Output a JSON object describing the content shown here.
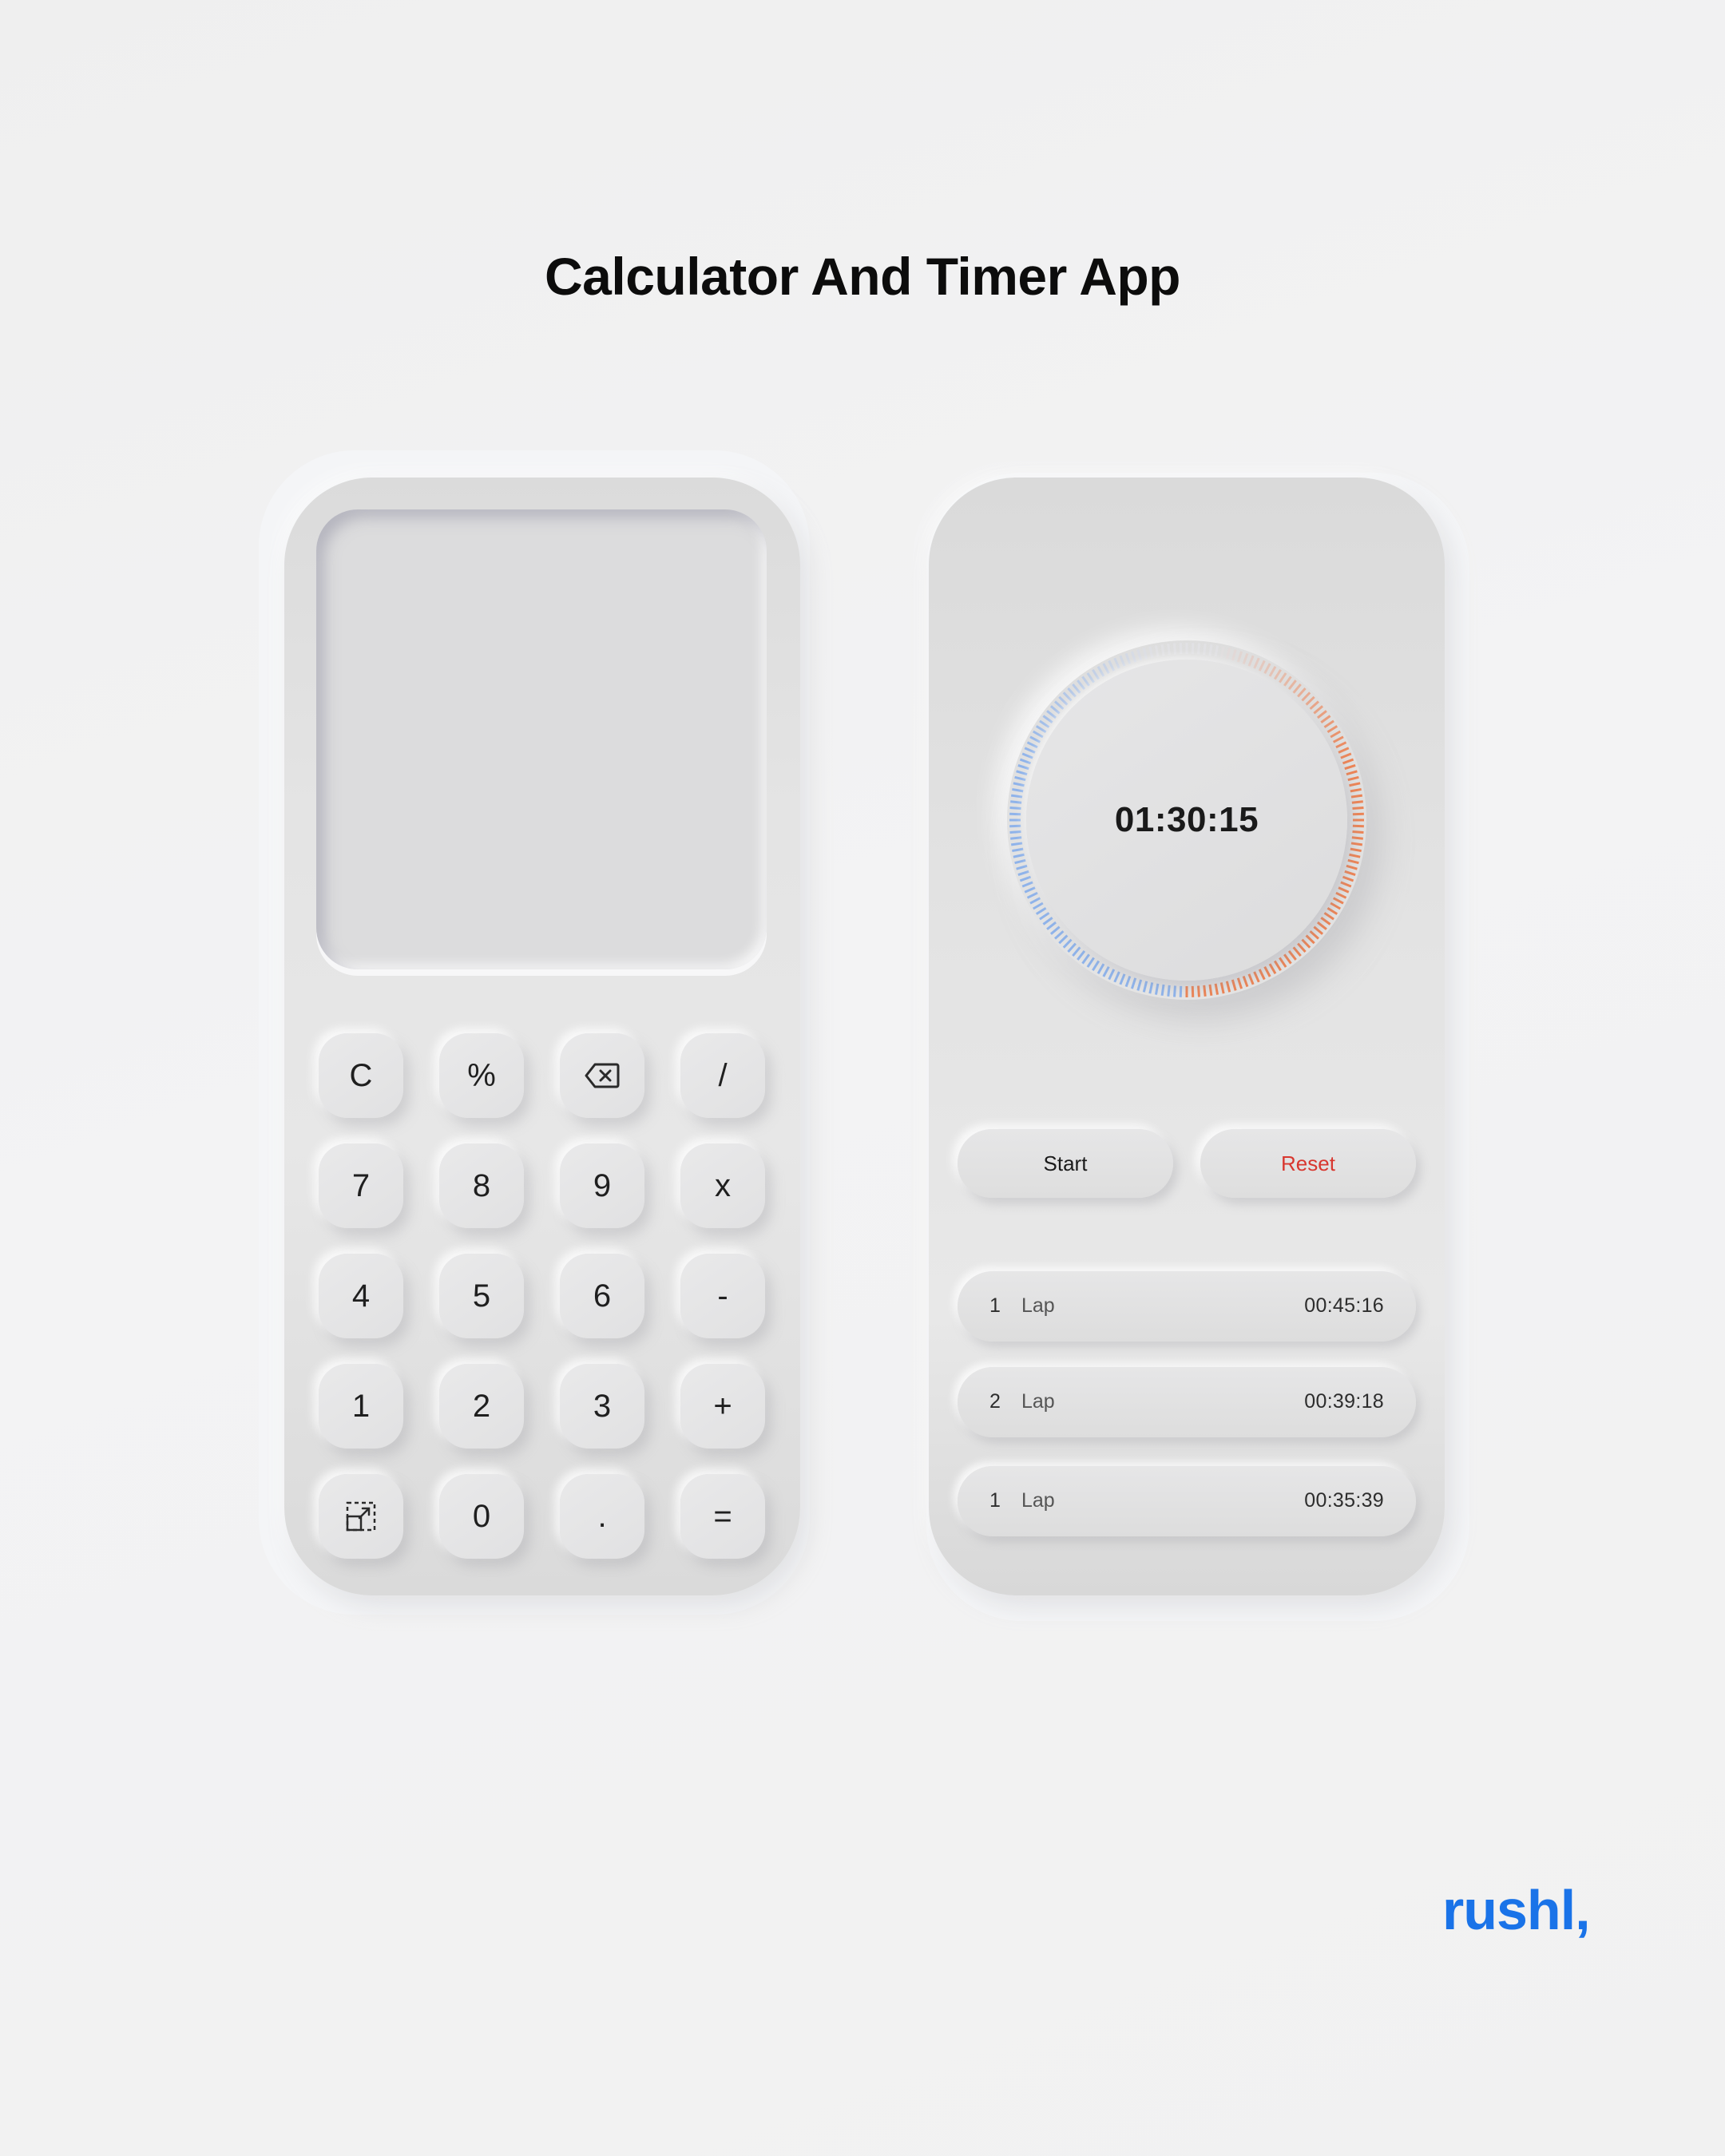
{
  "page": {
    "title": "Calculator And Timer App",
    "brand": "rushl,"
  },
  "colors": {
    "accent_blue": "#1a73e8",
    "reset_red": "#d8372f",
    "ring_blue": "#8fb3ea",
    "ring_orange": "#ec8456"
  },
  "calculator": {
    "display_value": "",
    "keys": [
      {
        "label": "C"
      },
      {
        "label": "%"
      },
      {
        "label": "",
        "icon": "backspace-icon"
      },
      {
        "label": "/"
      },
      {
        "label": "7"
      },
      {
        "label": "8"
      },
      {
        "label": "9"
      },
      {
        "label": "x"
      },
      {
        "label": "4"
      },
      {
        "label": "5"
      },
      {
        "label": "6"
      },
      {
        "label": "-"
      },
      {
        "label": "1"
      },
      {
        "label": "2"
      },
      {
        "label": "3"
      },
      {
        "label": "+"
      },
      {
        "label": "",
        "icon": "scale-icon"
      },
      {
        "label": "0"
      },
      {
        "label": "."
      },
      {
        "label": "="
      }
    ]
  },
  "timer": {
    "time": "01:30:15",
    "start_label": "Start",
    "reset_label": "Reset",
    "laps": [
      {
        "num": "1",
        "label": "Lap",
        "time": "00:45:16"
      },
      {
        "num": "2",
        "label": "Lap",
        "time": "00:39:18"
      },
      {
        "num": "1",
        "label": "Lap",
        "time": "00:35:39"
      }
    ]
  }
}
